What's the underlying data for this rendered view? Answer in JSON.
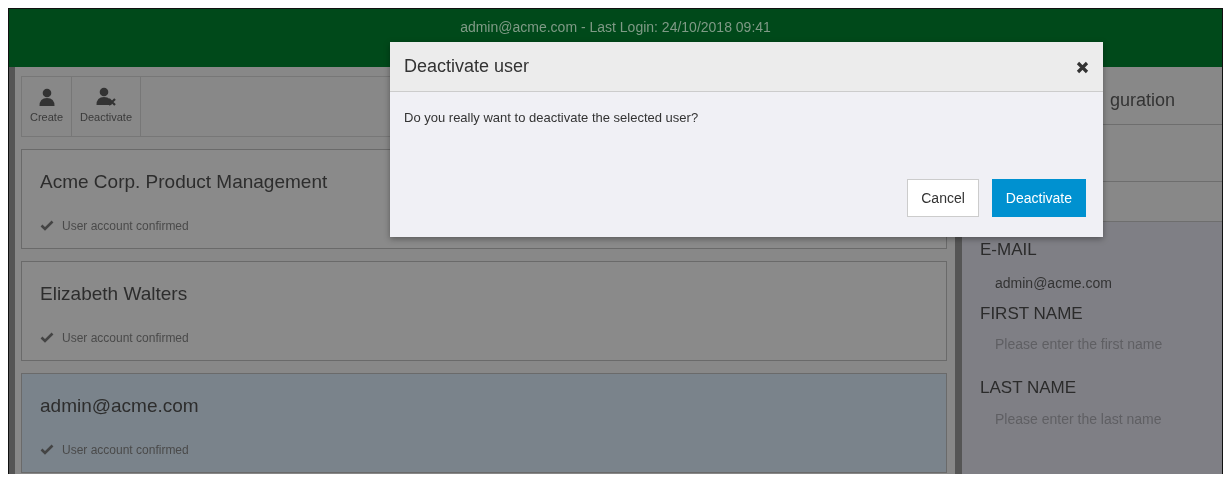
{
  "header": {
    "text": "admin@acme.com - Last Login: 24/10/2018 09:41"
  },
  "toolbar": [
    {
      "label": "Create",
      "kind": "create"
    },
    {
      "label": "Deactivate",
      "kind": "deactivate"
    }
  ],
  "users": [
    {
      "name": "Acme Corp. Product Management",
      "status": "User account confirmed",
      "selected": false
    },
    {
      "name": "Elizabeth Walters",
      "status": "User account confirmed",
      "selected": false
    },
    {
      "name": "admin@acme.com",
      "status": "User account confirmed",
      "selected": true
    }
  ],
  "details": {
    "title": "guration",
    "fields": [
      {
        "label": "E-MAIL",
        "value": "admin@acme.com"
      },
      {
        "label": "FIRST NAME",
        "placeholder": "Please enter the first name"
      },
      {
        "label": "LAST NAME",
        "placeholder": "Please enter the last name"
      }
    ]
  },
  "dialog": {
    "title": "Deactivate user",
    "message": "Do you really want to deactivate the selected user?",
    "buttons": [
      {
        "label": "Cancel",
        "kind": "secondary"
      },
      {
        "label": "Deactivate",
        "kind": "primary"
      }
    ]
  }
}
